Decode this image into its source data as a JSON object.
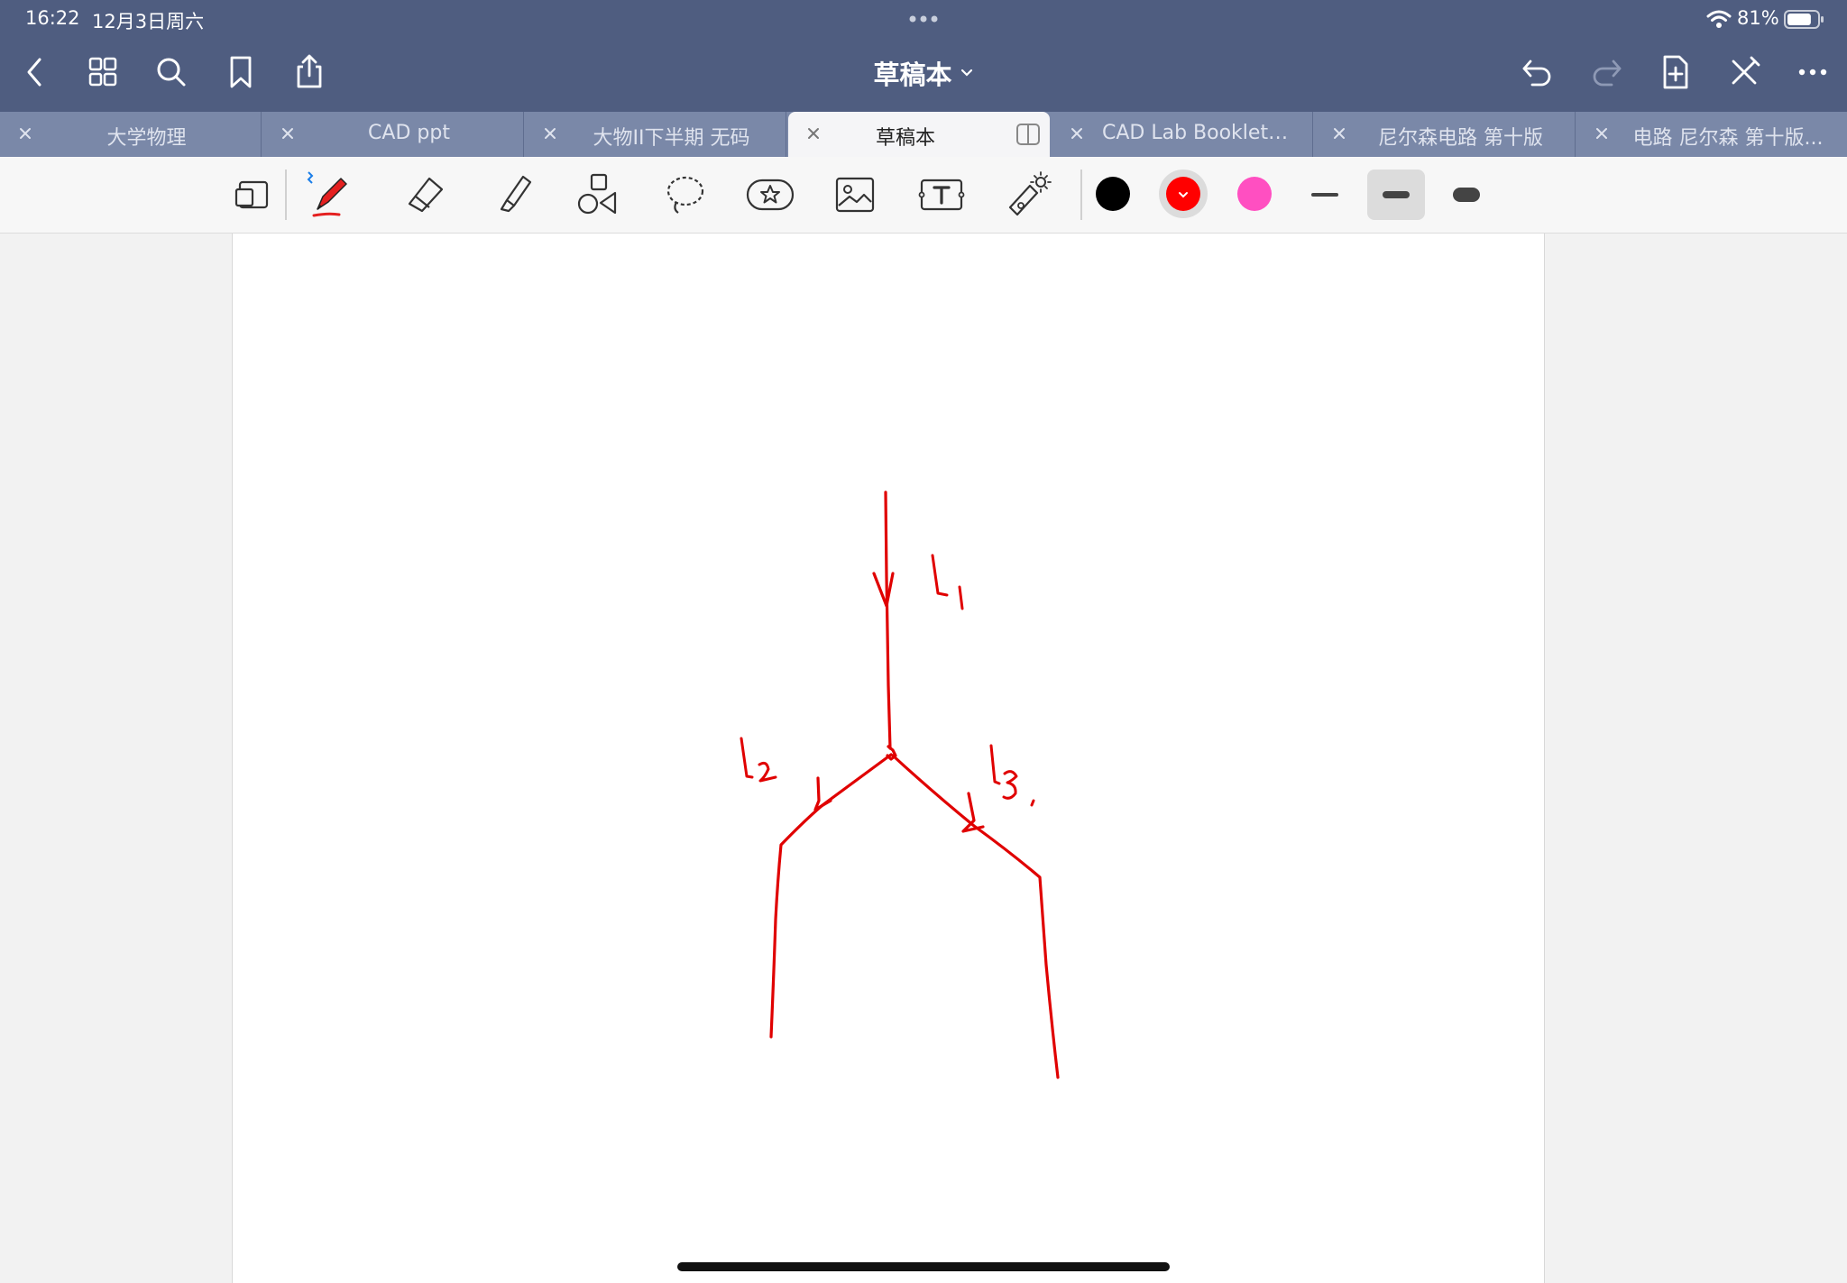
{
  "status_bar": {
    "time": "16:22",
    "date": "12月3日周六",
    "battery_percent": "81%",
    "battery_level": 0.81
  },
  "nav": {
    "title": "草稿本",
    "left_icons": [
      "back-icon",
      "grid-icon",
      "search-icon",
      "bookmark-icon",
      "share-icon"
    ],
    "right_icons": [
      "undo-icon",
      "redo-icon",
      "add-page-icon",
      "close-pen-icon",
      "more-icon"
    ]
  },
  "tabs": [
    {
      "label": "大学物理",
      "active": false
    },
    {
      "label": "CAD ppt",
      "active": false
    },
    {
      "label": "大物II下半期 无码",
      "active": false
    },
    {
      "label": "草稿本",
      "active": true
    },
    {
      "label": "CAD Lab Booklet 2...",
      "active": false
    },
    {
      "label": "尼尔森电路 第十版",
      "active": false
    },
    {
      "label": "电路 尼尔森 第十版...",
      "active": false
    }
  ],
  "toolbar": {
    "tools": [
      "page-view-icon",
      "pen-icon",
      "eraser-icon",
      "highlighter-icon",
      "shapes-icon",
      "lasso-icon",
      "sticker-icon",
      "image-icon",
      "text-icon",
      "laser-pointer-icon"
    ],
    "selected_tool": "pen-icon",
    "colors": [
      "#000000",
      "#ff0000",
      "#ff4fc1"
    ],
    "selected_color": "#ff0000",
    "stroke_widths": [
      "thin",
      "medium",
      "thick"
    ],
    "selected_width": "medium"
  },
  "canvas": {
    "ink_color": "#e00000",
    "labels": {
      "i1": "I₁",
      "i2": "I₂",
      "i3": "I₃"
    }
  }
}
